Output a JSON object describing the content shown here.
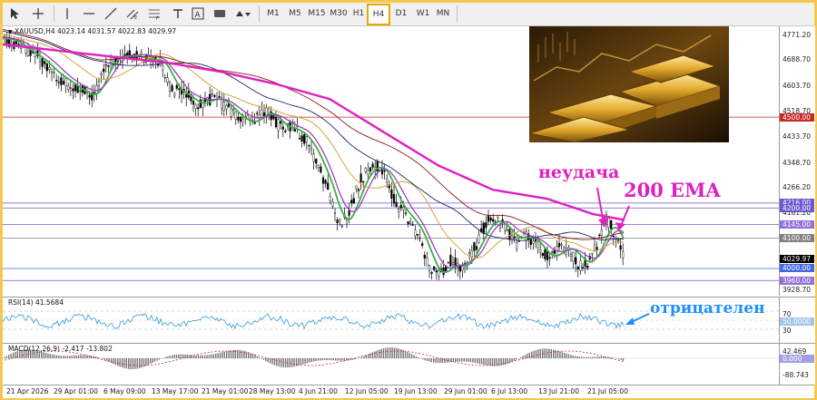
{
  "toolbar": {
    "timeframes": [
      "M1",
      "M5",
      "M15",
      "M30",
      "H1",
      "H4",
      "D1",
      "W1",
      "MN"
    ],
    "active_timeframe": "H4"
  },
  "chart": {
    "info": "XAUUSD,H4  4023.14 4031.57 4022.83 4029.97",
    "price_labels": [
      "4771.20",
      "4688.70",
      "4603.70",
      "4518.70",
      "4433.70",
      "4348.70",
      "4266.20",
      "4181.20",
      "3928.70"
    ],
    "level_tags": [
      {
        "text": "4500.00",
        "bg": "#c62828",
        "fg": "#ffffff",
        "value": 4500.0
      },
      {
        "text": "4216.00",
        "bg": "#6a5acd",
        "fg": "#ffffff",
        "value": 4216.0
      },
      {
        "text": "4200.00",
        "bg": "#6a5acd",
        "fg": "#ffffff",
        "value": 4200.0
      },
      {
        "text": "4145.00",
        "bg": "#9370db",
        "fg": "#ffffff",
        "value": 4145.0
      },
      {
        "text": "4100.00",
        "bg": "#808080",
        "fg": "#ffffff",
        "value": 4100.0
      },
      {
        "text": "4029.97",
        "bg": "#000000",
        "fg": "#ffffff",
        "value": 4029.97
      },
      {
        "text": "4000.00",
        "bg": "#4169e1",
        "fg": "#ffffff",
        "value": 4000.0
      },
      {
        "text": "3960.00",
        "bg": "#9370db",
        "fg": "#ffffff",
        "value": 3960.0
      }
    ],
    "annotations": {
      "fail": "неудача",
      "ema": "200 EMA",
      "negative": "отрицателен"
    }
  },
  "rsi": {
    "title": "RSI(14) 41.5684",
    "levels": [
      "70",
      "50.0000",
      "30"
    ]
  },
  "macd": {
    "title": "MACD(12,26,9) -2.417 -13.802",
    "levels": [
      "42.469",
      "0.000",
      "-88.743"
    ]
  },
  "time_axis": [
    "21 Apr 2026",
    "29 Apr 01:00",
    "6 May 09:00",
    "13 May 17:00",
    "21 May 01:00",
    "28 May 13:00",
    "4 Jun 21:00",
    "12 Jun 05:00",
    "19 Jun 13:00",
    "29 Jun 01:00",
    "6 Jul 13:00",
    "13 Jul 21:00",
    "21 Jul 05:00"
  ],
  "colors": {
    "ema200": "#e020c0",
    "ema_brown": "#8b1a1a",
    "ema_navy": "#1a2a6c",
    "ema_orange": "#d9a13b",
    "ma_purple": "#a040c0",
    "ma_green": "#3cb043",
    "accent_frame": "#f2c94c"
  }
}
